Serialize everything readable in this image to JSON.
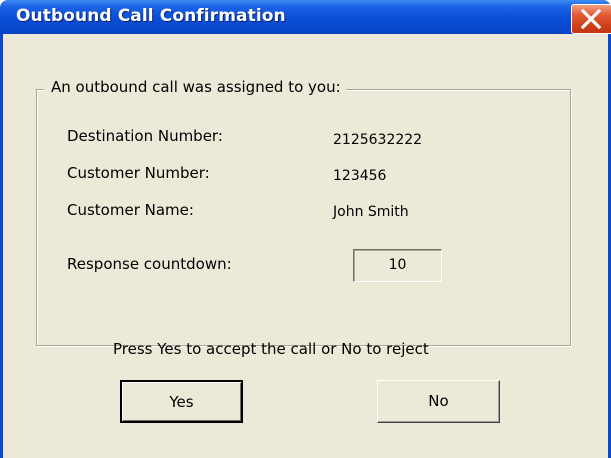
{
  "window": {
    "title": "Outbound Call Confirmation"
  },
  "group": {
    "legend": "An outbound call was assigned to you:"
  },
  "fields": {
    "destination_label": "Destination Number:",
    "destination_value": "2125632222",
    "customer_number_label": "Customer Number:",
    "customer_number_value": "123456",
    "customer_name_label": "Customer Name:",
    "customer_name_value": "John Smith",
    "countdown_label": "Response countdown:",
    "countdown_value": "10"
  },
  "prompt": "Press Yes to accept the call or No to reject",
  "buttons": {
    "yes": "Yes",
    "no": "No"
  },
  "icons": {
    "close": "close-icon"
  },
  "colors": {
    "titlebar": "#0a4fd8",
    "close_button": "#d2411a",
    "client_background": "#ece9d8"
  }
}
